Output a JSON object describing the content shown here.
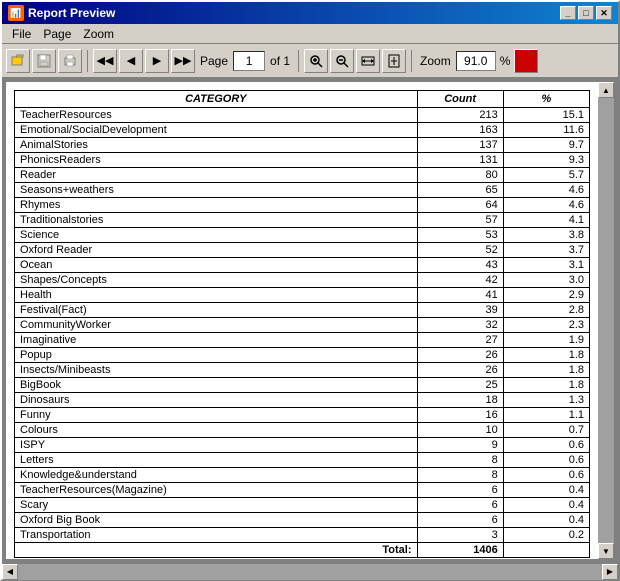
{
  "window": {
    "title": "Report Preview"
  },
  "menu": {
    "items": [
      "File",
      "Page",
      "Zoom"
    ]
  },
  "toolbar": {
    "page_label": "Page",
    "page_value": "1",
    "of_label": "of 1",
    "zoom_label": "Zoom",
    "zoom_value": "91.0",
    "zoom_pct": "%"
  },
  "table": {
    "headers": [
      "CATEGORY",
      "Count",
      "%"
    ],
    "rows": [
      {
        "category": "TeacherResources",
        "count": "213",
        "pct": "15.1"
      },
      {
        "category": "Emotional/SocialDevelopment",
        "count": "163",
        "pct": "11.6"
      },
      {
        "category": "AnimalStories",
        "count": "137",
        "pct": "9.7"
      },
      {
        "category": "PhonicsReaders",
        "count": "131",
        "pct": "9.3"
      },
      {
        "category": "Reader",
        "count": "80",
        "pct": "5.7"
      },
      {
        "category": "Seasons+weathers",
        "count": "65",
        "pct": "4.6"
      },
      {
        "category": "Rhymes",
        "count": "64",
        "pct": "4.6"
      },
      {
        "category": "Traditionalstories",
        "count": "57",
        "pct": "4.1"
      },
      {
        "category": "Science",
        "count": "53",
        "pct": "3.8"
      },
      {
        "category": "Oxford Reader",
        "count": "52",
        "pct": "3.7"
      },
      {
        "category": "Ocean",
        "count": "43",
        "pct": "3.1"
      },
      {
        "category": "Shapes/Concepts",
        "count": "42",
        "pct": "3.0"
      },
      {
        "category": "Health",
        "count": "41",
        "pct": "2.9"
      },
      {
        "category": "Festival(Fact)",
        "count": "39",
        "pct": "2.8"
      },
      {
        "category": "CommunityWorker",
        "count": "32",
        "pct": "2.3"
      },
      {
        "category": "Imaginative",
        "count": "27",
        "pct": "1.9"
      },
      {
        "category": "Popup",
        "count": "26",
        "pct": "1.8"
      },
      {
        "category": "Insects/Minibeasts",
        "count": "26",
        "pct": "1.8"
      },
      {
        "category": "BigBook",
        "count": "25",
        "pct": "1.8"
      },
      {
        "category": "Dinosaurs",
        "count": "18",
        "pct": "1.3"
      },
      {
        "category": "Funny",
        "count": "16",
        "pct": "1.1"
      },
      {
        "category": "Colours",
        "count": "10",
        "pct": "0.7"
      },
      {
        "category": "ISPY",
        "count": "9",
        "pct": "0.6"
      },
      {
        "category": "Letters",
        "count": "8",
        "pct": "0.6"
      },
      {
        "category": "Knowledge&understand",
        "count": "8",
        "pct": "0.6"
      },
      {
        "category": "TeacherResources(Magazine)",
        "count": "6",
        "pct": "0.4"
      },
      {
        "category": "Scary",
        "count": "6",
        "pct": "0.4"
      },
      {
        "category": "Oxford Big Book",
        "count": "6",
        "pct": "0.4"
      },
      {
        "category": "Transportation",
        "count": "3",
        "pct": "0.2"
      }
    ],
    "total_label": "Total:",
    "total_count": "1406",
    "total_pct": ""
  }
}
